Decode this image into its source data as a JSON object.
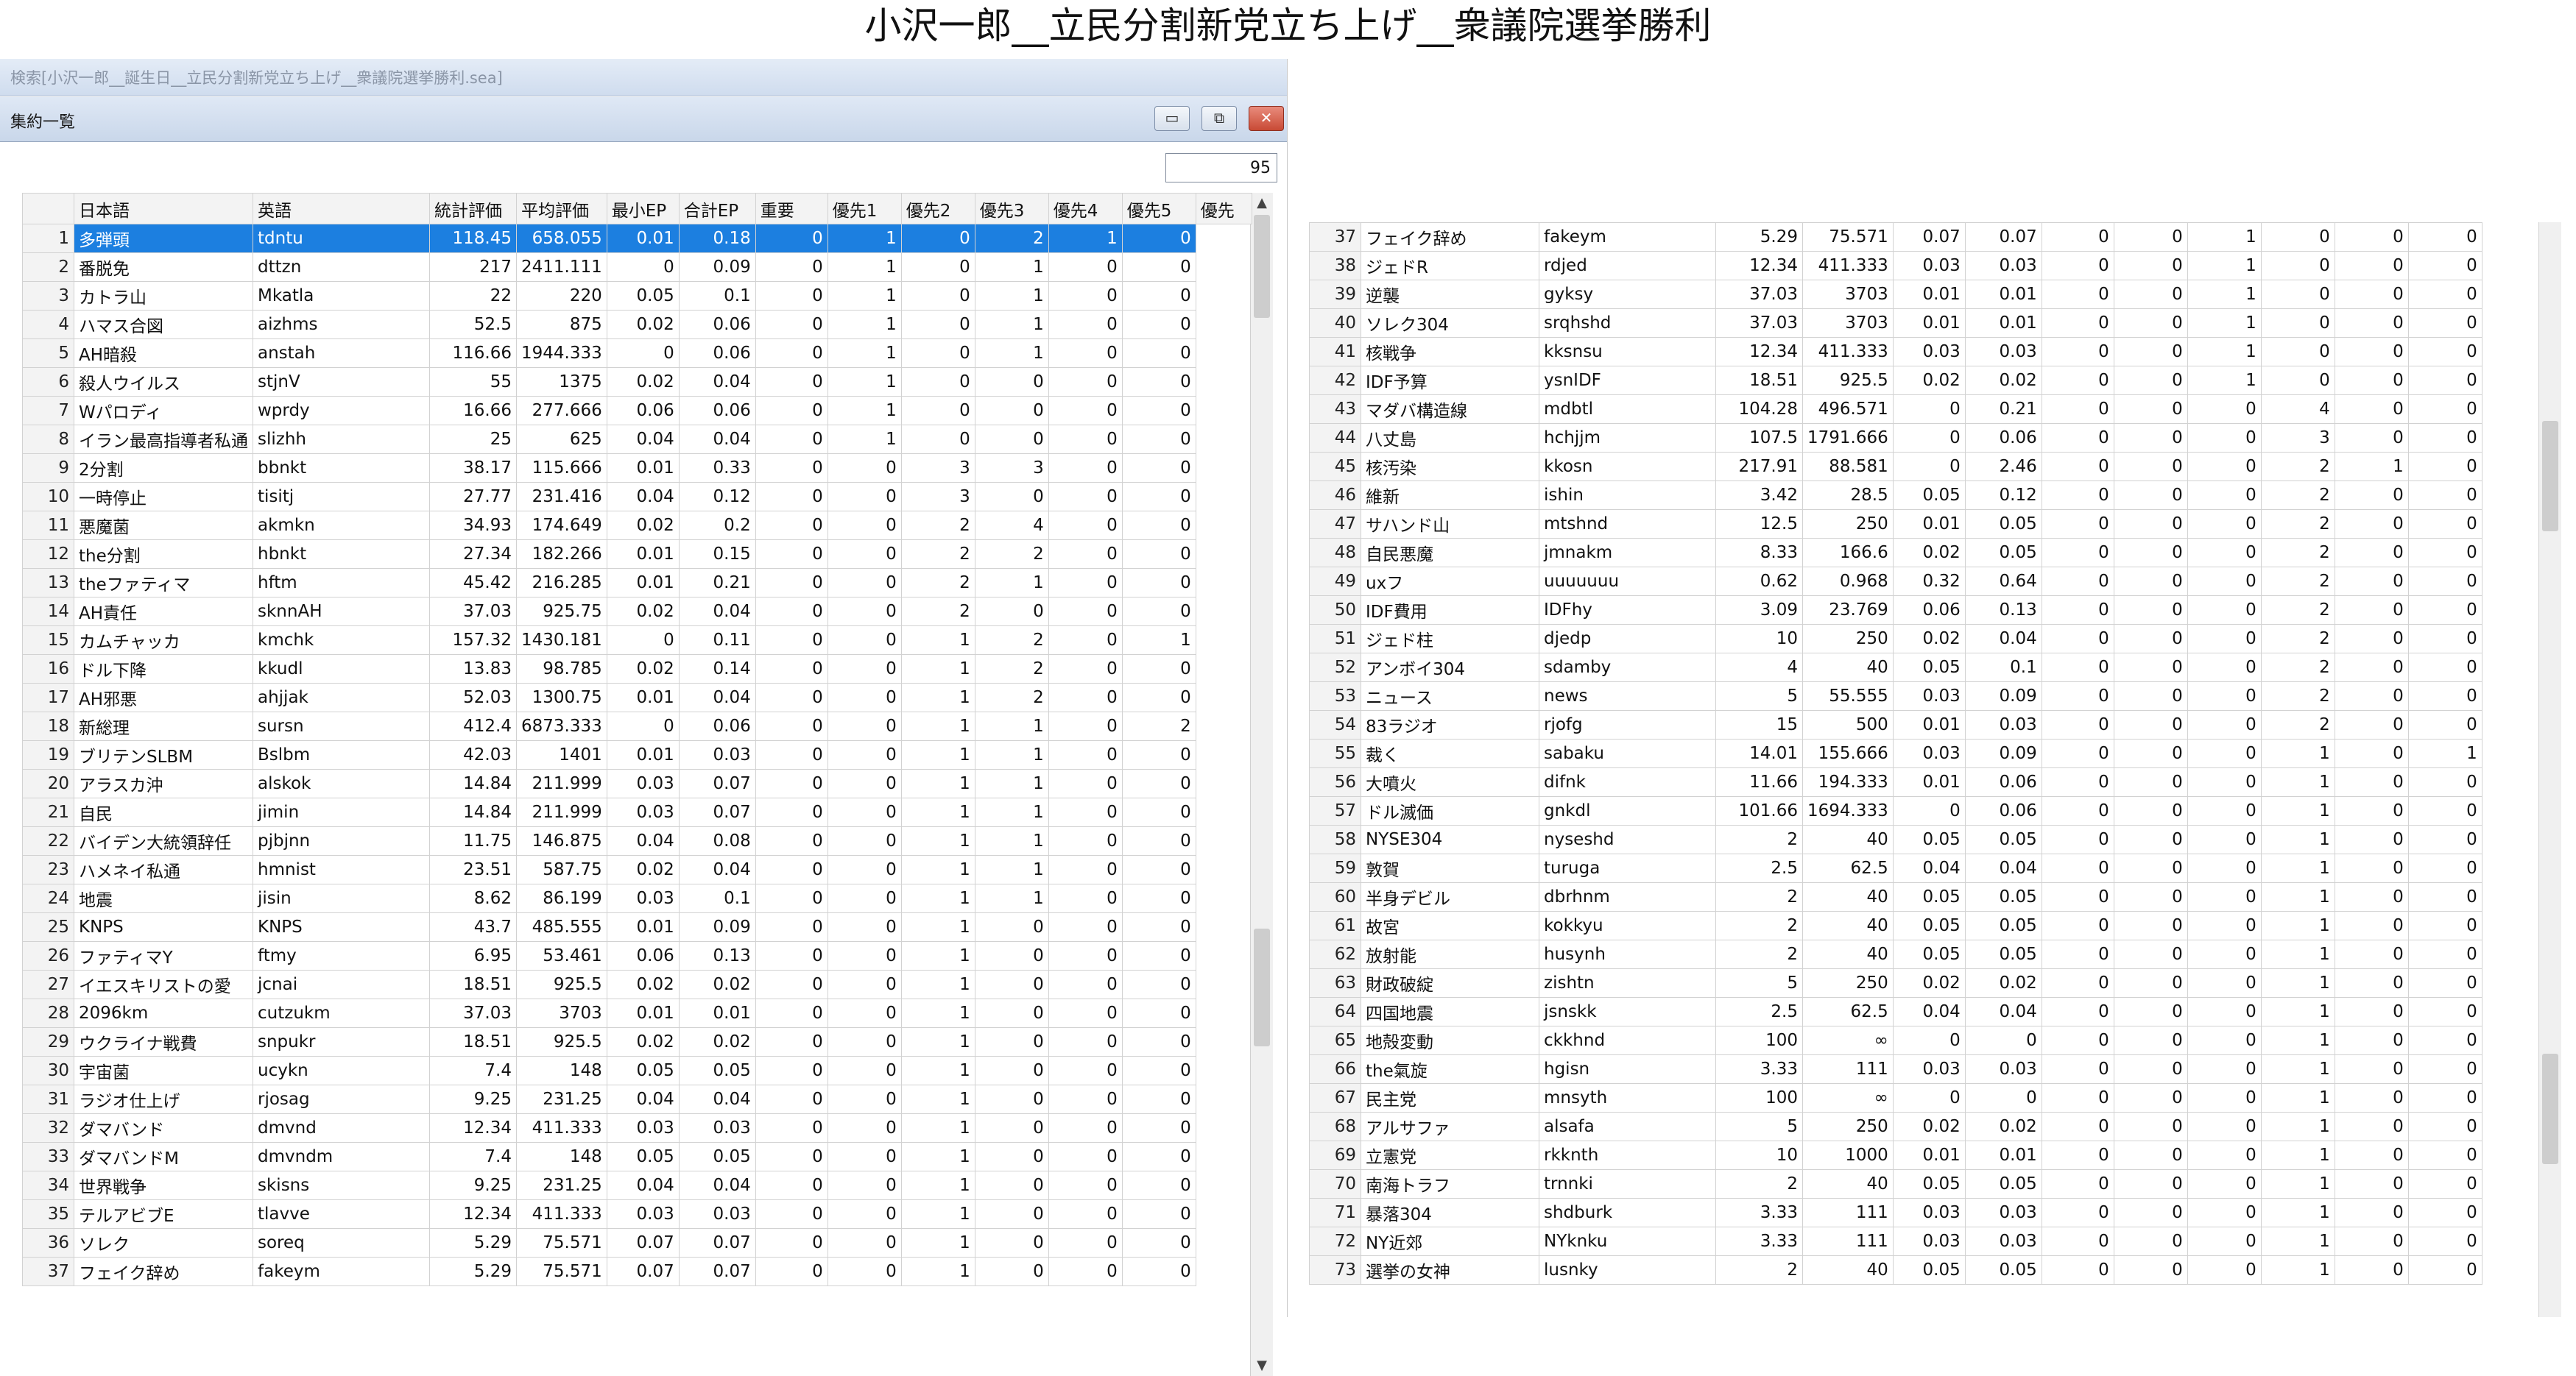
{
  "title": "小沢一郎__立民分割新党立ち上げ__衆議院選挙勝利",
  "search_bar_text": "検索[小沢一郎__誕生日__立民分割新党立ち上げ__衆議院選挙勝利.sea]",
  "window_title": "集約一覧",
  "count": "95",
  "buttons": {
    "minimize": "▭",
    "restore": "⧉",
    "close": "✕"
  },
  "headers": [
    "",
    "日本語",
    "英語",
    "統計評価",
    "平均評価",
    "最小EP",
    "合計EP",
    "重要",
    "優先1",
    "優先2",
    "優先3",
    "優先4",
    "優先5",
    "優先"
  ],
  "left_rows": [
    [
      "1",
      "多弾頭",
      "tdntu",
      "118.45",
      "658.055",
      "0.01",
      "0.18",
      "0",
      "1",
      "0",
      "2",
      "1",
      "0"
    ],
    [
      "2",
      "番脱免",
      "dttzn",
      "217",
      "2411.111",
      "0",
      "0.09",
      "0",
      "1",
      "0",
      "1",
      "0",
      "0"
    ],
    [
      "3",
      "カトラ山",
      "Mkatla",
      "22",
      "220",
      "0.05",
      "0.1",
      "0",
      "1",
      "0",
      "1",
      "0",
      "0"
    ],
    [
      "4",
      "ハマス合図",
      "aizhms",
      "52.5",
      "875",
      "0.02",
      "0.06",
      "0",
      "1",
      "0",
      "1",
      "0",
      "0"
    ],
    [
      "5",
      "AH暗殺",
      "anstah",
      "116.66",
      "1944.333",
      "0",
      "0.06",
      "0",
      "1",
      "0",
      "1",
      "0",
      "0"
    ],
    [
      "6",
      "殺人ウイルス",
      "stjnV",
      "55",
      "1375",
      "0.02",
      "0.04",
      "0",
      "1",
      "0",
      "0",
      "0",
      "0"
    ],
    [
      "7",
      "Wパロディ",
      "wprdy",
      "16.66",
      "277.666",
      "0.06",
      "0.06",
      "0",
      "1",
      "0",
      "0",
      "0",
      "0"
    ],
    [
      "8",
      "イラン最高指導者私通",
      "slizhh",
      "25",
      "625",
      "0.04",
      "0.04",
      "0",
      "1",
      "0",
      "0",
      "0",
      "0"
    ],
    [
      "9",
      "2分割",
      "bbnkt",
      "38.17",
      "115.666",
      "0.01",
      "0.33",
      "0",
      "0",
      "3",
      "3",
      "0",
      "0"
    ],
    [
      "10",
      "一時停止",
      "tisitj",
      "27.77",
      "231.416",
      "0.04",
      "0.12",
      "0",
      "0",
      "3",
      "0",
      "0",
      "0"
    ],
    [
      "11",
      "悪魔菌",
      "akmkn",
      "34.93",
      "174.649",
      "0.02",
      "0.2",
      "0",
      "0",
      "2",
      "4",
      "0",
      "0"
    ],
    [
      "12",
      "the分割",
      "hbnkt",
      "27.34",
      "182.266",
      "0.01",
      "0.15",
      "0",
      "0",
      "2",
      "2",
      "0",
      "0"
    ],
    [
      "13",
      "theファティマ",
      "hftm",
      "45.42",
      "216.285",
      "0.01",
      "0.21",
      "0",
      "0",
      "2",
      "1",
      "0",
      "0"
    ],
    [
      "14",
      "AH責任",
      "sknnAH",
      "37.03",
      "925.75",
      "0.02",
      "0.04",
      "0",
      "0",
      "2",
      "0",
      "0",
      "0"
    ],
    [
      "15",
      "カムチャッカ",
      "kmchk",
      "157.32",
      "1430.181",
      "0",
      "0.11",
      "0",
      "0",
      "1",
      "2",
      "0",
      "1"
    ],
    [
      "16",
      "ドル下降",
      "kkudl",
      "13.83",
      "98.785",
      "0.02",
      "0.14",
      "0",
      "0",
      "1",
      "2",
      "0",
      "0"
    ],
    [
      "17",
      "AH邪悪",
      "ahjjak",
      "52.03",
      "1300.75",
      "0.01",
      "0.04",
      "0",
      "0",
      "1",
      "2",
      "0",
      "0"
    ],
    [
      "18",
      "新総理",
      "sursn",
      "412.4",
      "6873.333",
      "0",
      "0.06",
      "0",
      "0",
      "1",
      "1",
      "0",
      "2"
    ],
    [
      "19",
      "ブリテンSLBM",
      "Bslbm",
      "42.03",
      "1401",
      "0.01",
      "0.03",
      "0",
      "0",
      "1",
      "1",
      "0",
      "0"
    ],
    [
      "20",
      "アラスカ沖",
      "alskok",
      "14.84",
      "211.999",
      "0.03",
      "0.07",
      "0",
      "0",
      "1",
      "1",
      "0",
      "0"
    ],
    [
      "21",
      "自民",
      "jimin",
      "14.84",
      "211.999",
      "0.03",
      "0.07",
      "0",
      "0",
      "1",
      "1",
      "0",
      "0"
    ],
    [
      "22",
      "バイデン大統領辞任",
      "pjbjnn",
      "11.75",
      "146.875",
      "0.04",
      "0.08",
      "0",
      "0",
      "1",
      "1",
      "0",
      "0"
    ],
    [
      "23",
      "ハメネイ私通",
      "hmnist",
      "23.51",
      "587.75",
      "0.02",
      "0.04",
      "0",
      "0",
      "1",
      "1",
      "0",
      "0"
    ],
    [
      "24",
      "地震",
      "jisin",
      "8.62",
      "86.199",
      "0.03",
      "0.1",
      "0",
      "0",
      "1",
      "1",
      "0",
      "0"
    ],
    [
      "25",
      "KNPS",
      "KNPS",
      "43.7",
      "485.555",
      "0.01",
      "0.09",
      "0",
      "0",
      "1",
      "0",
      "0",
      "0"
    ],
    [
      "26",
      "ファティマY",
      "ftmy",
      "6.95",
      "53.461",
      "0.06",
      "0.13",
      "0",
      "0",
      "1",
      "0",
      "0",
      "0"
    ],
    [
      "27",
      "イエスキリストの愛",
      "jcnai",
      "18.51",
      "925.5",
      "0.02",
      "0.02",
      "0",
      "0",
      "1",
      "0",
      "0",
      "0"
    ],
    [
      "28",
      "2096km",
      "cutzukm",
      "37.03",
      "3703",
      "0.01",
      "0.01",
      "0",
      "0",
      "1",
      "0",
      "0",
      "0"
    ],
    [
      "29",
      "ウクライナ戦費",
      "snpukr",
      "18.51",
      "925.5",
      "0.02",
      "0.02",
      "0",
      "0",
      "1",
      "0",
      "0",
      "0"
    ],
    [
      "30",
      "宇宙菌",
      "ucykn",
      "7.4",
      "148",
      "0.05",
      "0.05",
      "0",
      "0",
      "1",
      "0",
      "0",
      "0"
    ],
    [
      "31",
      "ラジオ仕上げ",
      "rjosag",
      "9.25",
      "231.25",
      "0.04",
      "0.04",
      "0",
      "0",
      "1",
      "0",
      "0",
      "0"
    ],
    [
      "32",
      "ダマバンド",
      "dmvnd",
      "12.34",
      "411.333",
      "0.03",
      "0.03",
      "0",
      "0",
      "1",
      "0",
      "0",
      "0"
    ],
    [
      "33",
      "ダマバンドM",
      "dmvndm",
      "7.4",
      "148",
      "0.05",
      "0.05",
      "0",
      "0",
      "1",
      "0",
      "0",
      "0"
    ],
    [
      "34",
      "世界戦争",
      "skisns",
      "9.25",
      "231.25",
      "0.04",
      "0.04",
      "0",
      "0",
      "1",
      "0",
      "0",
      "0"
    ],
    [
      "35",
      "テルアビブE",
      "tlavve",
      "12.34",
      "411.333",
      "0.03",
      "0.03",
      "0",
      "0",
      "1",
      "0",
      "0",
      "0"
    ],
    [
      "36",
      "ソレク",
      "soreq",
      "5.29",
      "75.571",
      "0.07",
      "0.07",
      "0",
      "0",
      "1",
      "0",
      "0",
      "0"
    ],
    [
      "37",
      "フェイク辞め",
      "fakeym",
      "5.29",
      "75.571",
      "0.07",
      "0.07",
      "0",
      "0",
      "1",
      "0",
      "0",
      "0"
    ]
  ],
  "right_rows": [
    [
      "37",
      "フェイク辞め",
      "fakeym",
      "5.29",
      "75.571",
      "0.07",
      "0.07",
      "0",
      "0",
      "1",
      "0",
      "0",
      "0"
    ],
    [
      "38",
      "ジェドR",
      "rdjed",
      "12.34",
      "411.333",
      "0.03",
      "0.03",
      "0",
      "0",
      "1",
      "0",
      "0",
      "0"
    ],
    [
      "39",
      "逆襲",
      "gyksy",
      "37.03",
      "3703",
      "0.01",
      "0.01",
      "0",
      "0",
      "1",
      "0",
      "0",
      "0"
    ],
    [
      "40",
      "ソレク304",
      "srqhshd",
      "37.03",
      "3703",
      "0.01",
      "0.01",
      "0",
      "0",
      "1",
      "0",
      "0",
      "0"
    ],
    [
      "41",
      "核戦争",
      "kksnsu",
      "12.34",
      "411.333",
      "0.03",
      "0.03",
      "0",
      "0",
      "1",
      "0",
      "0",
      "0"
    ],
    [
      "42",
      "IDF予算",
      "ysnIDF",
      "18.51",
      "925.5",
      "0.02",
      "0.02",
      "0",
      "0",
      "1",
      "0",
      "0",
      "0"
    ],
    [
      "43",
      "マダバ構造線",
      "mdbtl",
      "104.28",
      "496.571",
      "0",
      "0.21",
      "0",
      "0",
      "0",
      "4",
      "0",
      "0"
    ],
    [
      "44",
      "八丈島",
      "hchjjm",
      "107.5",
      "1791.666",
      "0",
      "0.06",
      "0",
      "0",
      "0",
      "3",
      "0",
      "0"
    ],
    [
      "45",
      "核汚染",
      "kkosn",
      "217.91",
      "88.581",
      "0",
      "2.46",
      "0",
      "0",
      "0",
      "2",
      "1",
      "0"
    ],
    [
      "46",
      "維新",
      "ishin",
      "3.42",
      "28.5",
      "0.05",
      "0.12",
      "0",
      "0",
      "0",
      "2",
      "0",
      "0"
    ],
    [
      "47",
      "サハンド山",
      "mtshnd",
      "12.5",
      "250",
      "0.01",
      "0.05",
      "0",
      "0",
      "0",
      "2",
      "0",
      "0"
    ],
    [
      "48",
      "自民悪魔",
      "jmnakm",
      "8.33",
      "166.6",
      "0.02",
      "0.05",
      "0",
      "0",
      "0",
      "2",
      "0",
      "0"
    ],
    [
      "49",
      "uxフ",
      "uuuuuuu",
      "0.62",
      "0.968",
      "0.32",
      "0.64",
      "0",
      "0",
      "0",
      "2",
      "0",
      "0"
    ],
    [
      "50",
      "IDF費用",
      "IDFhy",
      "3.09",
      "23.769",
      "0.06",
      "0.13",
      "0",
      "0",
      "0",
      "2",
      "0",
      "0"
    ],
    [
      "51",
      "ジェド柱",
      "djedp",
      "10",
      "250",
      "0.02",
      "0.04",
      "0",
      "0",
      "0",
      "2",
      "0",
      "0"
    ],
    [
      "52",
      "アンボイ304",
      "sdamby",
      "4",
      "40",
      "0.05",
      "0.1",
      "0",
      "0",
      "0",
      "2",
      "0",
      "0"
    ],
    [
      "53",
      "ニュース",
      "news",
      "5",
      "55.555",
      "0.03",
      "0.09",
      "0",
      "0",
      "0",
      "2",
      "0",
      "0"
    ],
    [
      "54",
      "83ラジオ",
      "rjofg",
      "15",
      "500",
      "0.01",
      "0.03",
      "0",
      "0",
      "0",
      "2",
      "0",
      "0"
    ],
    [
      "55",
      "裁く",
      "sabaku",
      "14.01",
      "155.666",
      "0.03",
      "0.09",
      "0",
      "0",
      "0",
      "1",
      "0",
      "1"
    ],
    [
      "56",
      "大噴火",
      "difnk",
      "11.66",
      "194.333",
      "0.01",
      "0.06",
      "0",
      "0",
      "0",
      "1",
      "0",
      "0"
    ],
    [
      "57",
      "ドル滅価",
      "gnkdl",
      "101.66",
      "1694.333",
      "0",
      "0.06",
      "0",
      "0",
      "0",
      "1",
      "0",
      "0"
    ],
    [
      "58",
      "NYSE304",
      "nyseshd",
      "2",
      "40",
      "0.05",
      "0.05",
      "0",
      "0",
      "0",
      "1",
      "0",
      "0"
    ],
    [
      "59",
      "敦賀",
      "turuga",
      "2.5",
      "62.5",
      "0.04",
      "0.04",
      "0",
      "0",
      "0",
      "1",
      "0",
      "0"
    ],
    [
      "60",
      "半身デビル",
      "dbrhnm",
      "2",
      "40",
      "0.05",
      "0.05",
      "0",
      "0",
      "0",
      "1",
      "0",
      "0"
    ],
    [
      "61",
      "故宮",
      "kokkyu",
      "2",
      "40",
      "0.05",
      "0.05",
      "0",
      "0",
      "0",
      "1",
      "0",
      "0"
    ],
    [
      "62",
      "放射能",
      "husynh",
      "2",
      "40",
      "0.05",
      "0.05",
      "0",
      "0",
      "0",
      "1",
      "0",
      "0"
    ],
    [
      "63",
      "財政破綻",
      "zishtn",
      "5",
      "250",
      "0.02",
      "0.02",
      "0",
      "0",
      "0",
      "1",
      "0",
      "0"
    ],
    [
      "64",
      "四国地震",
      "jsnskk",
      "2.5",
      "62.5",
      "0.04",
      "0.04",
      "0",
      "0",
      "0",
      "1",
      "0",
      "0"
    ],
    [
      "65",
      "地殻変動",
      "ckkhnd",
      "100",
      "∞",
      "0",
      "0",
      "0",
      "0",
      "0",
      "1",
      "0",
      "0"
    ],
    [
      "66",
      "the氣旋",
      "hgisn",
      "3.33",
      "111",
      "0.03",
      "0.03",
      "0",
      "0",
      "0",
      "1",
      "0",
      "0"
    ],
    [
      "67",
      "民主党",
      "mnsyth",
      "100",
      "∞",
      "0",
      "0",
      "0",
      "0",
      "0",
      "1",
      "0",
      "0"
    ],
    [
      "68",
      "アルサファ",
      "alsafa",
      "5",
      "250",
      "0.02",
      "0.02",
      "0",
      "0",
      "0",
      "1",
      "0",
      "0"
    ],
    [
      "69",
      "立憲党",
      "rkknth",
      "10",
      "1000",
      "0.01",
      "0.01",
      "0",
      "0",
      "0",
      "1",
      "0",
      "0"
    ],
    [
      "70",
      "南海トラフ",
      "trnnki",
      "2",
      "40",
      "0.05",
      "0.05",
      "0",
      "0",
      "0",
      "1",
      "0",
      "0"
    ],
    [
      "71",
      "暴落304",
      "shdburk",
      "3.33",
      "111",
      "0.03",
      "0.03",
      "0",
      "0",
      "0",
      "1",
      "0",
      "0"
    ],
    [
      "72",
      "NY近郊",
      "NYknku",
      "3.33",
      "111",
      "0.03",
      "0.03",
      "0",
      "0",
      "0",
      "1",
      "0",
      "0"
    ],
    [
      "73",
      "選挙の女神",
      "lusnky",
      "2",
      "40",
      "0.05",
      "0.05",
      "0",
      "0",
      "0",
      "1",
      "0",
      "0"
    ]
  ]
}
